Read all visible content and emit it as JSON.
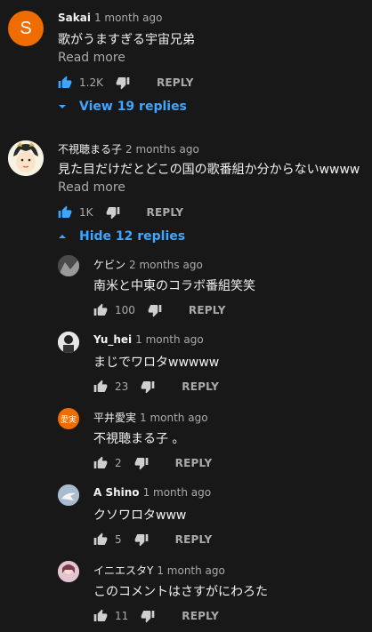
{
  "colors": {
    "background": "#181818",
    "text": "#f1f1f1",
    "secondary": "#aaaaaa",
    "link": "#3ea6ff"
  },
  "top_comments": [
    {
      "author": "Sakai",
      "time": "1 month ago",
      "text": "歌がうますぎる宇宙兄弟",
      "read_more": "Read more",
      "likes": "1.2K",
      "reply": "REPLY",
      "avatar_letter": "S",
      "avatar_color": "#ef6c00",
      "toggle": "View 19 replies",
      "toggle_icon": "chevron-down-icon"
    },
    {
      "author": "不視聴まる子",
      "time": "2 months ago",
      "text": "見た目だけだとどこの国の歌番組か分からないwwww",
      "read_more": "Read more",
      "likes": "1K",
      "reply": "REPLY",
      "avatar_icon": "anime-avatar-icon",
      "toggle": "Hide 12 replies",
      "toggle_icon": "chevron-up-icon"
    }
  ],
  "replies": [
    {
      "author": "ケビン",
      "time": "2 months ago",
      "text": "南米と中東のコラボ番組笑笑",
      "likes": "100",
      "reply": "REPLY",
      "avatar_icon": "photo-avatar-icon"
    },
    {
      "author": "Yu_hei",
      "time": "1 month ago",
      "text": "まじでワロタwwwww",
      "likes": "23",
      "reply": "REPLY",
      "avatar_icon": "photo-avatar-icon"
    },
    {
      "author": "平井愛実",
      "time": "1 month ago",
      "text": "不視聴まる子 。",
      "likes": "2",
      "reply": "REPLY",
      "avatar_text": "愛実",
      "avatar_color": "#ef6c00"
    },
    {
      "author": "A Shino",
      "time": "1 month ago",
      "text": "クソワロタwww",
      "likes": "5",
      "reply": "REPLY",
      "avatar_icon": "bird-avatar-icon"
    },
    {
      "author": "イニエスタY",
      "time": "1 month ago",
      "text": "このコメントはさすがにわろた",
      "likes": "11",
      "reply": "REPLY",
      "avatar_icon": "photo-avatar-icon"
    }
  ]
}
